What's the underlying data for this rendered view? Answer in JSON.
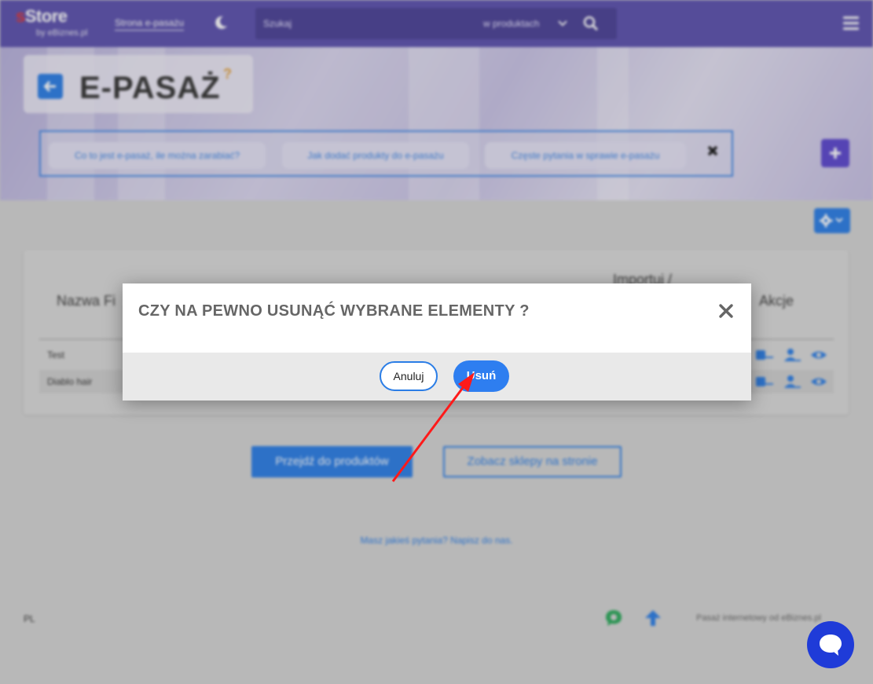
{
  "header": {
    "logo_main_s": "s",
    "logo_main_rest": "Store",
    "logo_sub": "by eBiznes.pl",
    "nav_link": "Strona e-pasażu",
    "search_placeholder": "Szukaj",
    "search_scope": "w produktach",
    "icons": [
      "moon-icon",
      "chevron-down-icon",
      "search-icon",
      "hamburger-menu-icon"
    ]
  },
  "hero": {
    "title": "E-PASAŻ",
    "help_mark": "?",
    "faq_links": [
      "Co to jest e-pasaż, ile można zarabiać?",
      "Jak dodać produkty do e-pasażu",
      "Częste pytania w sprawie e-pasażu"
    ]
  },
  "table": {
    "headers": [
      "Nazwa Fi",
      "Importuj /",
      "Akcje"
    ],
    "rows": [
      {
        "name": "Test"
      },
      {
        "name": "Diablo hair"
      }
    ]
  },
  "actions": {
    "go_products": "Przejdź do produktów",
    "see_shops": "Zobacz sklepy na stronie"
  },
  "footer": {
    "contact": "Masz jakieś pytania? Napisz do nas.",
    "lang": "PL",
    "note": "Pasaż internetowy od eBiznes.pl"
  },
  "modal": {
    "title": "CZY NA PEWNO USUNĄĆ WYBRANE ELEMENTY ?",
    "cancel_label": "Anuluj",
    "delete_label": "Usuń"
  },
  "colors": {
    "topbar": "#5b50ae",
    "accent": "#2a7de6",
    "delete_button": "#2e7ef0",
    "chat_widget": "#1f3bd8",
    "annotation_arrow": "#ff1a1a"
  }
}
